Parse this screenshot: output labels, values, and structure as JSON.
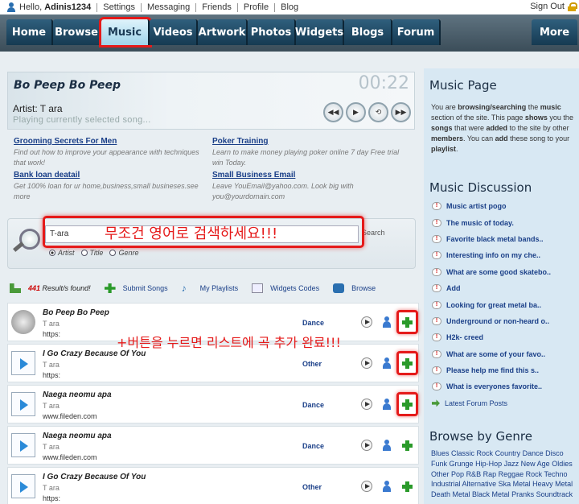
{
  "topbar": {
    "hello": "Hello,",
    "username": "Adinis1234",
    "links": [
      "Settings",
      "Messaging",
      "Friends",
      "Profile",
      "Blog"
    ],
    "signout": "Sign Out"
  },
  "nav": {
    "items": [
      {
        "label": "Home",
        "w": 58
      },
      {
        "label": "Browse",
        "w": 60
      },
      {
        "label": "Music",
        "w": 60,
        "active": true
      },
      {
        "label": "Videos",
        "w": 60
      },
      {
        "label": "Artwork",
        "w": 62
      },
      {
        "label": "Photos",
        "w": 60
      },
      {
        "label": "Widgets",
        "w": 60
      },
      {
        "label": "Blogs",
        "w": 60
      },
      {
        "label": "Forum",
        "w": 60
      }
    ],
    "more": "More",
    "accent": "#e51a1a"
  },
  "player": {
    "title": "Bo Peep Bo Peep",
    "time": "00:22",
    "artist_label": "Artist:",
    "artist": "T ara",
    "status": "Playing currently selected song..."
  },
  "ads": [
    {
      "title": "Grooming Secrets For Men",
      "desc": "Find out how to improve your appearance with techniques that work!"
    },
    {
      "title": "Poker Training",
      "desc": "Learn to make money playing poker online 7 day Free trial win Today."
    },
    {
      "title": "Bank loan deatail",
      "desc": "Get 100% loan for ur home,business,small busineses.see more"
    },
    {
      "title": "Small Business Email",
      "desc": "Leave YouEmail@yahoo.com. Look big with you@yourdomain.com"
    }
  ],
  "search": {
    "value": "T-ara",
    "button": "Search",
    "note": "무조건 영어로 검색하세요!!!",
    "options": [
      "Artist",
      "Title",
      "Genre"
    ]
  },
  "toolbar": {
    "count": "441",
    "count_label": "Result/s found!",
    "submit": "Submit Songs",
    "playlists": "My Playlists",
    "widgets": "Widgets Codes",
    "browse": "Browse"
  },
  "plus_note": "+버튼을 누르면 리스트에 곡 추가 완료!!!",
  "songs": [
    {
      "title": "Bo Peep Bo Peep",
      "artist": "T ara",
      "url": "https:",
      "genre": "Dance",
      "thumb": "speaker",
      "highlight": true
    },
    {
      "title": "I Go Crazy Because Of You",
      "artist": "T ara",
      "url": "https:",
      "genre": "Other",
      "thumb": "file",
      "highlight": true
    },
    {
      "title": "Naega neomu apa",
      "artist": "T ara",
      "url": "www.fileden.com",
      "genre": "Dance",
      "thumb": "file",
      "highlight": true
    },
    {
      "title": "Naega neomu apa",
      "artist": "T ara",
      "url": "www.fileden.com",
      "genre": "Dance",
      "thumb": "file",
      "highlight": false
    },
    {
      "title": "I Go Crazy Because Of You",
      "artist": "T ara",
      "url": "https:",
      "genre": "Other",
      "thumb": "file",
      "highlight": false
    }
  ],
  "sidebar": {
    "music_page_title": "Music Page",
    "desc_parts": [
      {
        "t": "You are ",
        "b": false
      },
      {
        "t": "browsing/searching",
        "b": true
      },
      {
        "t": " the ",
        "b": false
      },
      {
        "t": "music",
        "b": true
      },
      {
        "t": " section of the site. This page ",
        "b": false
      },
      {
        "t": "shows",
        "b": true
      },
      {
        "t": " you the ",
        "b": false
      },
      {
        "t": "songs",
        "b": true
      },
      {
        "t": " that were ",
        "b": false
      },
      {
        "t": "added",
        "b": true
      },
      {
        "t": " to the site by other ",
        "b": false
      },
      {
        "t": "members",
        "b": true
      },
      {
        "t": ". You can ",
        "b": false
      },
      {
        "t": "add",
        "b": true
      },
      {
        "t": " these song to your ",
        "b": false
      },
      {
        "t": "playlist",
        "b": true
      },
      {
        "t": ".",
        "b": false
      }
    ],
    "discussion_title": "Music Discussion",
    "discussions": [
      "Music artist pogo",
      "The music of today.",
      "Favorite black metal bands..",
      "Interesting info on my che..",
      "What are some good skatebo..",
      "Add",
      "Looking for great metal ba..",
      "Underground or non-heard o..",
      "H2k- creed",
      "What are some of your favo..",
      "Please help me find this s..",
      "What is everyones favorite.."
    ],
    "latest": "Latest Forum Posts",
    "genre_title": "Browse by Genre",
    "genres": [
      "Blues",
      "Classic Rock",
      "Country",
      "Dance",
      "Disco",
      "Funk",
      "Grunge",
      "Hip-Hop",
      "Jazz",
      "New Age",
      "Oldies",
      "Other",
      "Pop",
      "R&B",
      "Rap",
      "Reggae",
      "Rock",
      "Techno",
      "Industrial",
      "Alternative",
      "Ska",
      "Metal",
      "Heavy Metal",
      "Death Metal",
      "Black Metal",
      "Pranks",
      "Soundtrack"
    ]
  }
}
